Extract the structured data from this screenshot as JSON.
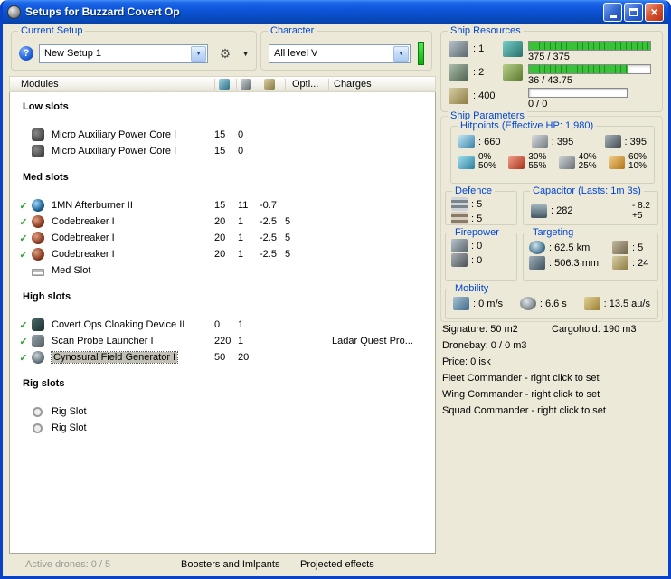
{
  "window": {
    "title": "Setups for Buzzard Covert Op"
  },
  "icons": {
    "help": "?",
    "close": "×",
    "check": "✓",
    "arrow_down": "▼",
    "gear": "⚙"
  },
  "left": {
    "current_setup": {
      "label": "Current Setup",
      "value": "New Setup 1"
    },
    "character": {
      "label": "Character",
      "value": "All level V"
    },
    "columns": {
      "modules": "Modules",
      "opti": "Opti...",
      "charges": "Charges"
    },
    "sections": [
      {
        "title": "Low slots",
        "rows": [
          {
            "name": "Micro Auxiliary Power Core I",
            "c1": "15",
            "c2": "0",
            "c3": "",
            "c4": "",
            "charges": ""
          },
          {
            "name": "Micro Auxiliary Power Core I",
            "c1": "15",
            "c2": "0",
            "c3": "",
            "c4": "",
            "charges": ""
          }
        ]
      },
      {
        "title": "Med slots",
        "rows": [
          {
            "name": "1MN Afterburner II",
            "c1": "15",
            "c2": "11",
            "c3": "-0.7",
            "c4": "",
            "charges": ""
          },
          {
            "name": "Codebreaker I",
            "c1": "20",
            "c2": "1",
            "c3": "-2.5",
            "c4": "5",
            "charges": ""
          },
          {
            "name": "Codebreaker I",
            "c1": "20",
            "c2": "1",
            "c3": "-2.5",
            "c4": "5",
            "charges": ""
          },
          {
            "name": "Codebreaker I",
            "c1": "20",
            "c2": "1",
            "c3": "-2.5",
            "c4": "5",
            "charges": ""
          },
          {
            "name": "Med Slot",
            "c1": "",
            "c2": "",
            "c3": "",
            "c4": "",
            "charges": ""
          }
        ]
      },
      {
        "title": "High slots",
        "rows": [
          {
            "name": "Covert Ops Cloaking Device II",
            "c1": "0",
            "c2": "1",
            "c3": "",
            "c4": "",
            "charges": ""
          },
          {
            "name": "Scan Probe Launcher I",
            "c1": "220",
            "c2": "1",
            "c3": "",
            "c4": "",
            "charges": "Ladar Quest Pro..."
          },
          {
            "name": "Cynosural Field Generator I",
            "c1": "50",
            "c2": "20",
            "c3": "",
            "c4": "",
            "charges": ""
          }
        ]
      },
      {
        "title": "Rig slots",
        "rows": [
          {
            "name": "Rig Slot",
            "c1": "",
            "c2": "",
            "c3": "",
            "c4": "",
            "charges": ""
          },
          {
            "name": "Rig Slot",
            "c1": "",
            "c2": "",
            "c3": "",
            "c4": "",
            "charges": ""
          }
        ]
      }
    ],
    "statusbar": {
      "active_drones": "Active drones: 0 / 5",
      "boosters": "Boosters and Imlpants",
      "projected": "Projected effects"
    }
  },
  "right": {
    "ship_resources": {
      "label": "Ship Resources",
      "rows": [
        {
          "value": ": 1",
          "bar_text": "375 / 375",
          "bar_pct": 100
        },
        {
          "value": ": 2",
          "bar_text": "36 / 43.75",
          "bar_pct": 82
        },
        {
          "value": ": 400",
          "bar_text": "0 / 0",
          "bar_pct": 0
        }
      ]
    },
    "ship_parameters": {
      "label": "Ship Parameters",
      "hitpoints": {
        "label": "Hitpoints (Effective HP: 1,980)",
        "shield": ": 660",
        "armor": ": 395",
        "hull": ": 395",
        "resists": [
          {
            "top": "0%",
            "bottom": "50%"
          },
          {
            "top": "30%",
            "bottom": "55%"
          },
          {
            "top": "40%",
            "bottom": "25%"
          },
          {
            "top": "60%",
            "bottom": "10%"
          }
        ]
      },
      "defence": {
        "label": "Defence",
        "v1": ": 5",
        "v2": ": 5"
      },
      "capacitor": {
        "label": "Capacitor (Lasts: 1m 3s)",
        "value": ": 282",
        "drain": "- 8.2",
        "recharge": "+5"
      },
      "firepower": {
        "label": "Firepower",
        "v1": ": 0",
        "v2": ": 0"
      },
      "targeting": {
        "label": "Targeting",
        "range": ": 62.5 km",
        "max_targets": ": 5",
        "scan_res": ": 506.3 mm",
        "sensor_strength": ": 24"
      },
      "mobility": {
        "label": "Mobility",
        "speed": ": 0 m/s",
        "align": ": 6.6 s",
        "warp": ": 13.5 au/s"
      }
    },
    "info": {
      "signature": "Signature: 50 m2",
      "cargohold": "Cargohold: 190 m3",
      "dronebay": "Dronebay: 0 / 0 m3",
      "price": "Price: 0 isk",
      "fleet": "Fleet Commander - right click to set",
      "wing": "Wing Commander - right click to set",
      "squad": "Squad Commander - right click to set"
    }
  }
}
